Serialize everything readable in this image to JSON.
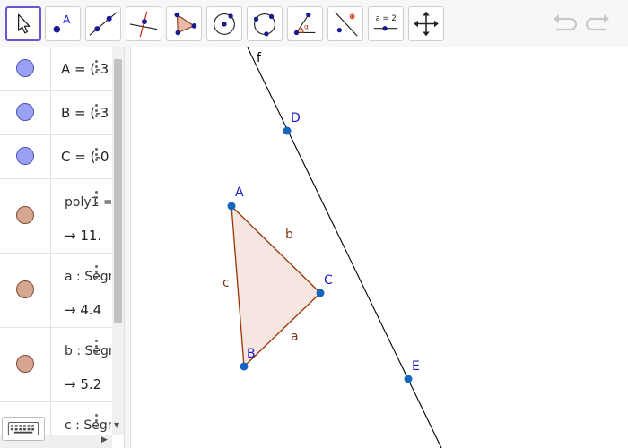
{
  "toolbar": {
    "tools": [
      {
        "name": "move-tool",
        "active": true
      },
      {
        "name": "point-tool",
        "glyph": "A"
      },
      {
        "name": "line-tool"
      },
      {
        "name": "perpendicular-line-tool"
      },
      {
        "name": "polygon-tool"
      },
      {
        "name": "circle-center-tool"
      },
      {
        "name": "circle-three-points-tool"
      },
      {
        "name": "angle-tool"
      },
      {
        "name": "reflect-tool"
      },
      {
        "name": "slider-tool",
        "glyph": "a = 2"
      },
      {
        "name": "move-graphics-view-tool"
      }
    ]
  },
  "algebra": {
    "rows": [
      {
        "kind": "point",
        "def": "A = (-3"
      },
      {
        "kind": "point",
        "def": "B = (-3"
      },
      {
        "kind": "point",
        "def": "C = (-0"
      },
      {
        "kind": "shape",
        "def": "poly1 =",
        "value": "→  11."
      },
      {
        "kind": "shape",
        "def": "a : Segm",
        "value": "→  4.4"
      },
      {
        "kind": "shape",
        "def": "b : Segm",
        "value": "→  5.2"
      },
      {
        "kind": "shape",
        "def": "c : Segm"
      }
    ]
  },
  "graphics": {
    "points": [
      {
        "label": "A"
      },
      {
        "label": "B"
      },
      {
        "label": "C"
      },
      {
        "label": "D"
      },
      {
        "label": "E"
      }
    ],
    "segments": [
      {
        "label": "a"
      },
      {
        "label": "b"
      },
      {
        "label": "c"
      }
    ],
    "line": {
      "label": "f"
    },
    "colors": {
      "point": "#1565c0",
      "point_label": "#1a1acc",
      "segment": "#993300",
      "polygon_fill": "#f5e6e1",
      "line": "#000000"
    }
  }
}
